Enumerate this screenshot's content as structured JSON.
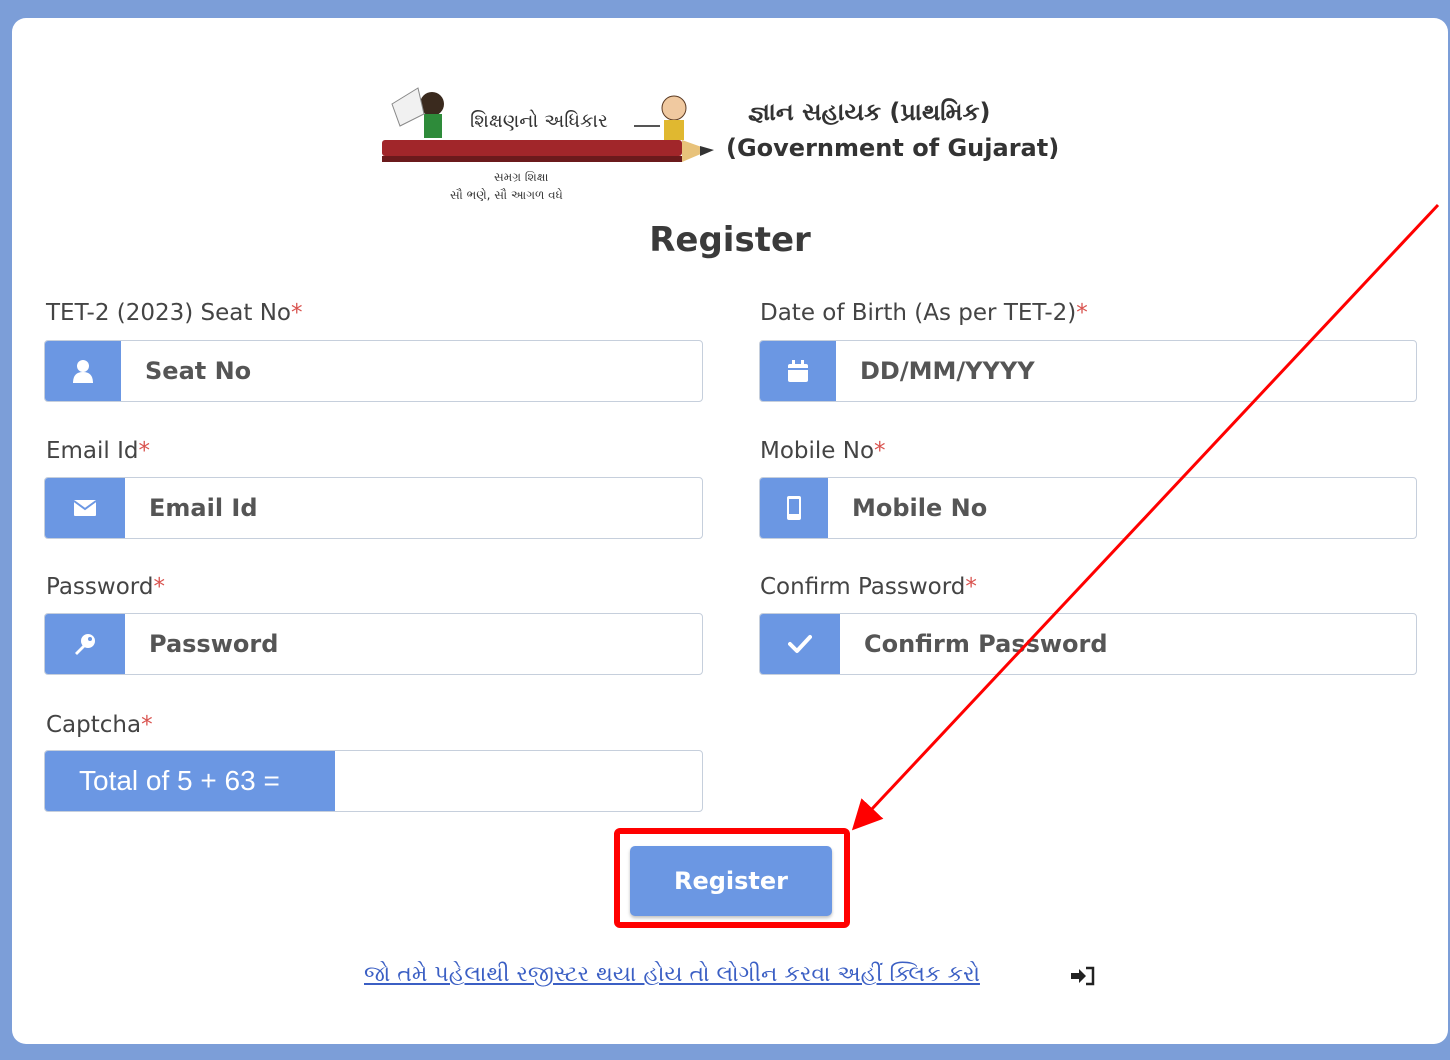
{
  "header": {
    "logo_title": "શિક્ષણનો અધિકાર",
    "logo_sub1": "સમગ્ર શિક્ષા",
    "logo_sub2": "સૌ ભણે, સૌ આગળ વધે",
    "brand_title": "જ્ઞાન સહાયક (પ્રાથમિક)",
    "brand_sub": "(Government of Gujarat)"
  },
  "page_title": "Register",
  "form": {
    "required_mark": "*",
    "seat_no": {
      "label": "TET-2 (2023) Seat No",
      "placeholder": "Seat No",
      "icon": "user-icon"
    },
    "dob": {
      "label": "Date of Birth (As per TET-2)",
      "placeholder": "DD/MM/YYYY",
      "icon": "calendar-icon"
    },
    "email": {
      "label": "Email Id",
      "placeholder": "Email Id",
      "icon": "envelope-icon"
    },
    "mobile": {
      "label": "Mobile No",
      "placeholder": "Mobile No",
      "icon": "mobile-icon"
    },
    "password": {
      "label": "Password",
      "placeholder": "Password",
      "icon": "key-icon"
    },
    "confirm_password": {
      "label": "Confirm Password",
      "placeholder": "Confirm Password",
      "icon": "check-icon"
    },
    "captcha": {
      "label": "Captcha",
      "question": "Total of 5 + 63 =",
      "value": ""
    }
  },
  "register_button": "Register",
  "login_link": "જો તમે પહેલાથી રજીસ્ટર થયા હોય તો લોગીન કરવા અહીં ક્લિક કરો",
  "colors": {
    "accent": "#6b97e3",
    "background": "#7c9ed8",
    "required": "#d9534f",
    "annotation": "#ff0000"
  }
}
